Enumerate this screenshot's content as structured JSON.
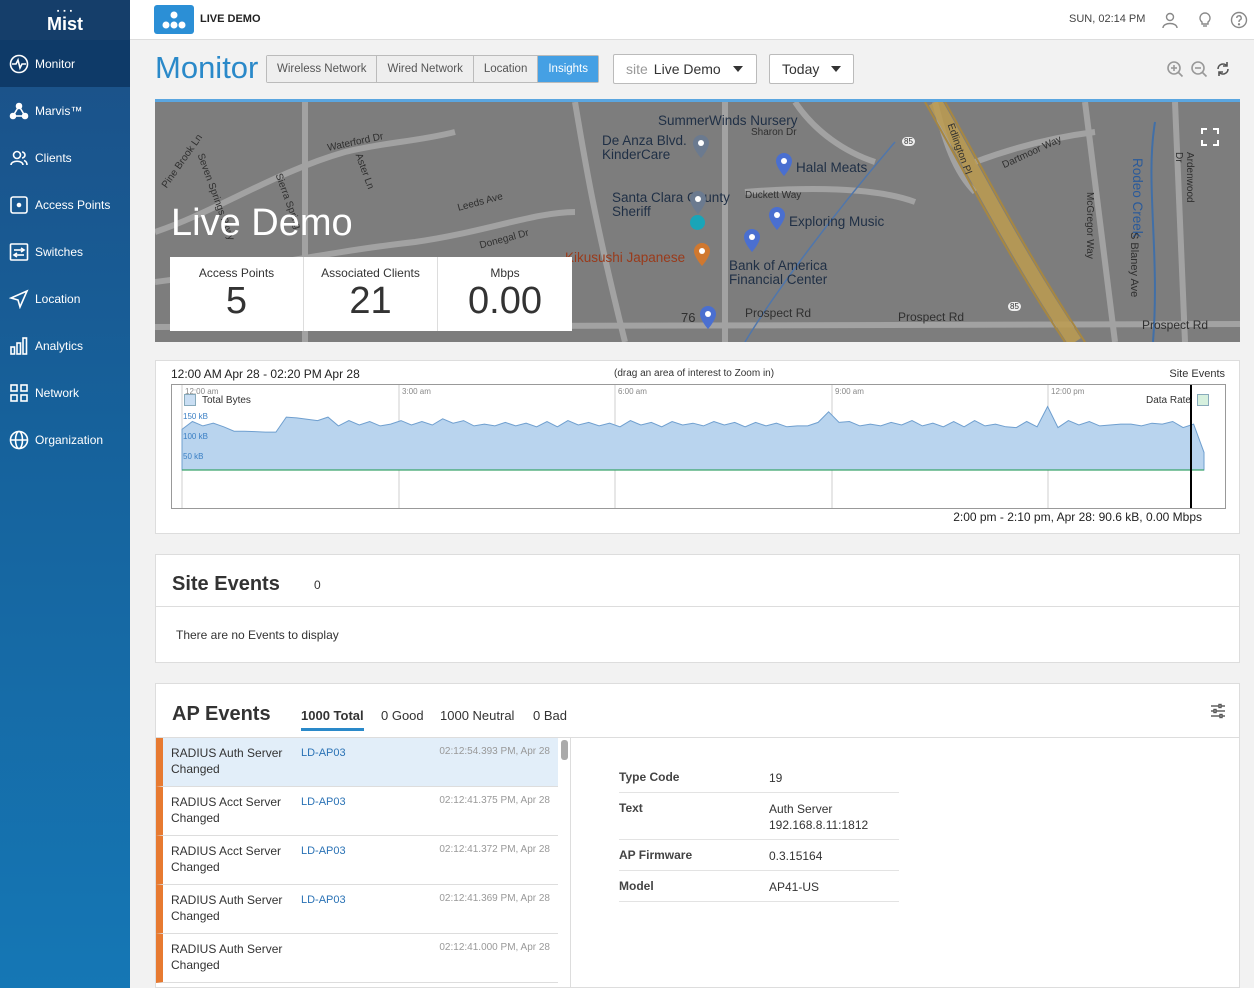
{
  "sidebar": {
    "logo": "Mist",
    "items": [
      {
        "label": "Monitor",
        "icon": "pulse-icon"
      },
      {
        "label": "Marvis™",
        "icon": "network-nodes-icon"
      },
      {
        "label": "Clients",
        "icon": "users-icon"
      },
      {
        "label": "Access Points",
        "icon": "access-point-icon"
      },
      {
        "label": "Switches",
        "icon": "switch-icon"
      },
      {
        "label": "Location",
        "icon": "location-arrow-icon"
      },
      {
        "label": "Analytics",
        "icon": "bar-chart-icon"
      },
      {
        "label": "Network",
        "icon": "network-icon"
      },
      {
        "label": "Organization",
        "icon": "globe-icon"
      }
    ]
  },
  "topbar": {
    "org_name": "LIVE DEMO",
    "clock": "SUN, 02:14 PM"
  },
  "header": {
    "title": "Monitor",
    "tabs": [
      "Wireless Network",
      "Wired Network",
      "Location",
      "Insights"
    ],
    "active_tab": "Insights",
    "site_prefix": "site",
    "site_value": "Live Demo",
    "period_value": "Today"
  },
  "map": {
    "site_name": "Live Demo",
    "stats": [
      {
        "label": "Access Points",
        "value": "5"
      },
      {
        "label": "Associated Clients",
        "value": "21"
      },
      {
        "label": "Mbps",
        "value": "0.00"
      }
    ],
    "places": [
      "SummerWinds Nursery",
      "De Anza Blvd. KinderCare",
      "Halal Meats",
      "Santa Clara County Sheriff",
      "Exploring Music",
      "Kikusushi Japanese",
      "Bank of America Financial Center",
      "Rodeo Creek"
    ],
    "streets": [
      "Waterford Dr",
      "Sharon Dr",
      "Edlington Pl",
      "Dartmoor Way",
      "Ardenwood Dr",
      "Pine Brook Ln",
      "Seven Springs Pkwy",
      "Sierra Spring",
      "Aster Ln",
      "Leeds Ave",
      "Donegal Dr",
      "Duckett Way",
      "McGregor Way",
      "S Blaney Ave",
      "Prospect Rd",
      "Prospect Rd",
      "Prospect Rd",
      "76",
      "85",
      "85"
    ]
  },
  "timeline": {
    "range": "12:00 AM Apr 28 - 02:20 PM Apr 28",
    "hint": "(drag an area of interest to Zoom in)",
    "events_label": "Site Events",
    "legend_left": "Total Bytes",
    "legend_right": "Data Rate",
    "summary": "2:00 pm - 2:10 pm, Apr 28: 90.6 kB, 0.00 Mbps"
  },
  "chart_data": {
    "type": "area",
    "series": [
      {
        "name": "Total Bytes",
        "values": [
          92,
          110,
          100,
          106,
          98,
          88,
          88,
          87,
          86,
          86,
          120,
          118,
          115,
          112,
          120,
          100,
          112,
          102,
          110,
          100,
          104,
          112,
          102,
          110,
          102,
          116,
          106,
          112,
          100,
          104,
          100,
          108,
          100,
          106,
          98,
          110,
          98,
          112,
          102,
          108,
          100,
          106,
          98,
          112,
          102,
          108,
          98,
          110,
          102,
          106,
          100,
          110,
          102,
          108,
          98,
          108,
          100,
          106,
          98,
          100,
          100,
          108,
          132,
          108,
          110,
          100,
          104,
          100,
          108,
          102,
          112,
          100,
          106,
          98,
          110,
          98,
          112,
          100,
          104,
          98,
          96,
          110,
          98,
          144,
          96,
          112,
          102,
          110,
          100,
          102,
          104,
          104,
          100,
          106,
          104,
          110,
          96,
          104,
          40
        ]
      }
    ],
    "x_ticks": [
      "12:00 am",
      "3:00 am",
      "6:00 am",
      "9:00 am",
      "12:00 pm"
    ],
    "y_ticks": [
      "150 kB",
      "100 kB",
      "50 kB"
    ],
    "ylim": [
      0,
      170
    ],
    "grid": true,
    "legend": "top-left and top-right"
  },
  "site_events": {
    "title": "Site Events",
    "count": "0",
    "empty_text": "There are no Events to display"
  },
  "ap_events": {
    "title": "AP Events",
    "tabs": [
      "1000 Total",
      "0 Good",
      "1000 Neutral",
      "0 Bad"
    ],
    "rows": [
      {
        "name": "RADIUS Auth Server Changed",
        "ap": "LD-AP03",
        "time": "02:12:54.393 PM, Apr 28"
      },
      {
        "name": "RADIUS Acct Server Changed",
        "ap": "LD-AP03",
        "time": "02:12:41.375 PM, Apr 28"
      },
      {
        "name": "RADIUS Acct Server Changed",
        "ap": "LD-AP03",
        "time": "02:12:41.372 PM, Apr 28"
      },
      {
        "name": "RADIUS Auth Server Changed",
        "ap": "LD-AP03",
        "time": "02:12:41.369 PM, Apr 28"
      },
      {
        "name": "RADIUS Auth Server Changed",
        "ap": "",
        "time": "02:12:41.000 PM, Apr 28"
      }
    ],
    "detail": [
      {
        "key": "Type Code",
        "value": "19"
      },
      {
        "key": "Text",
        "value": "Auth Server 192.168.8.11:1812"
      },
      {
        "key": "AP Firmware",
        "value": "0.3.15164"
      },
      {
        "key": "Model",
        "value": "AP41-US"
      }
    ]
  }
}
